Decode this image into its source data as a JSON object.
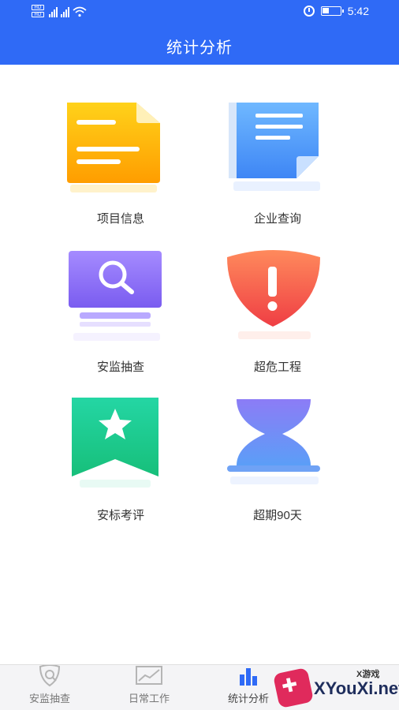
{
  "status_bar": {
    "time": "5:42"
  },
  "header": {
    "title": "统计分析"
  },
  "grid": [
    {
      "label": "项目信息",
      "icon": "document-folder-icon",
      "color": "#ffb300"
    },
    {
      "label": "企业查询",
      "icon": "document-icon",
      "color": "#4a9bf7"
    },
    {
      "label": "安监抽查",
      "icon": "search-monitor-icon",
      "color": "#8a6ff5"
    },
    {
      "label": "超危工程",
      "icon": "warning-shield-icon",
      "color": "#f4564d"
    },
    {
      "label": "安标考评",
      "icon": "star-badge-icon",
      "color": "#1fd3a0"
    },
    {
      "label": "超期90天",
      "icon": "hourglass-icon",
      "color": "#5f8df7"
    }
  ],
  "bottom_nav": [
    {
      "label": "安监抽查",
      "icon": "inspect-icon"
    },
    {
      "label": "日常工作",
      "icon": "chart-line-icon"
    },
    {
      "label": "统计分析",
      "icon": "bar-chart-icon",
      "active": true
    }
  ],
  "watermark": {
    "brand": "XYouXi.net",
    "tag": "X游戏"
  }
}
